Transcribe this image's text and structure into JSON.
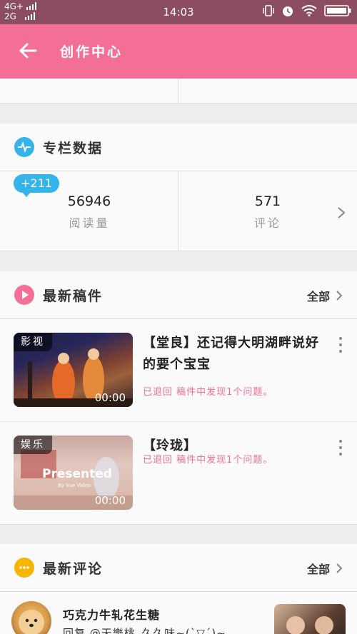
{
  "status_bar": {
    "network_line1": "4G+",
    "network_line2": "2G",
    "time": "14:03"
  },
  "header": {
    "title": "创作中心",
    "back_icon": "arrow-left-icon"
  },
  "column_data": {
    "title": "专栏数据",
    "icon": "pulse-icon",
    "badge": "+211",
    "stats": [
      {
        "value": "56946",
        "label": "阅读量"
      },
      {
        "value": "571",
        "label": "评论"
      }
    ]
  },
  "latest_drafts": {
    "title": "最新稿件",
    "more_label": "全部",
    "icon": "play-icon",
    "items": [
      {
        "tag": "影视",
        "duration": "00:00",
        "title": "【堂良】还记得大明湖畔说好的要个宝宝",
        "status": "已退回 稿件中发现1个问题。"
      },
      {
        "tag": "娱乐",
        "duration": "00:00",
        "title": "【玲珑】",
        "status": "已退回 稿件中发现1个问题。",
        "thumb_text": "Presented",
        "thumb_subtext": "By Vue Video"
      }
    ]
  },
  "latest_comments": {
    "title": "最新评论",
    "more_label": "全部",
    "icon": "chat-icon",
    "items": [
      {
        "user": "巧克力牛轧花生糖",
        "text": "回复 @天樂桃_久久味~(`▽´)~"
      }
    ]
  },
  "colors": {
    "accent": "#f36f96",
    "status_bar": "#8b4d5f",
    "badge": "#35b4ec",
    "comments_icon": "#f7b500"
  }
}
